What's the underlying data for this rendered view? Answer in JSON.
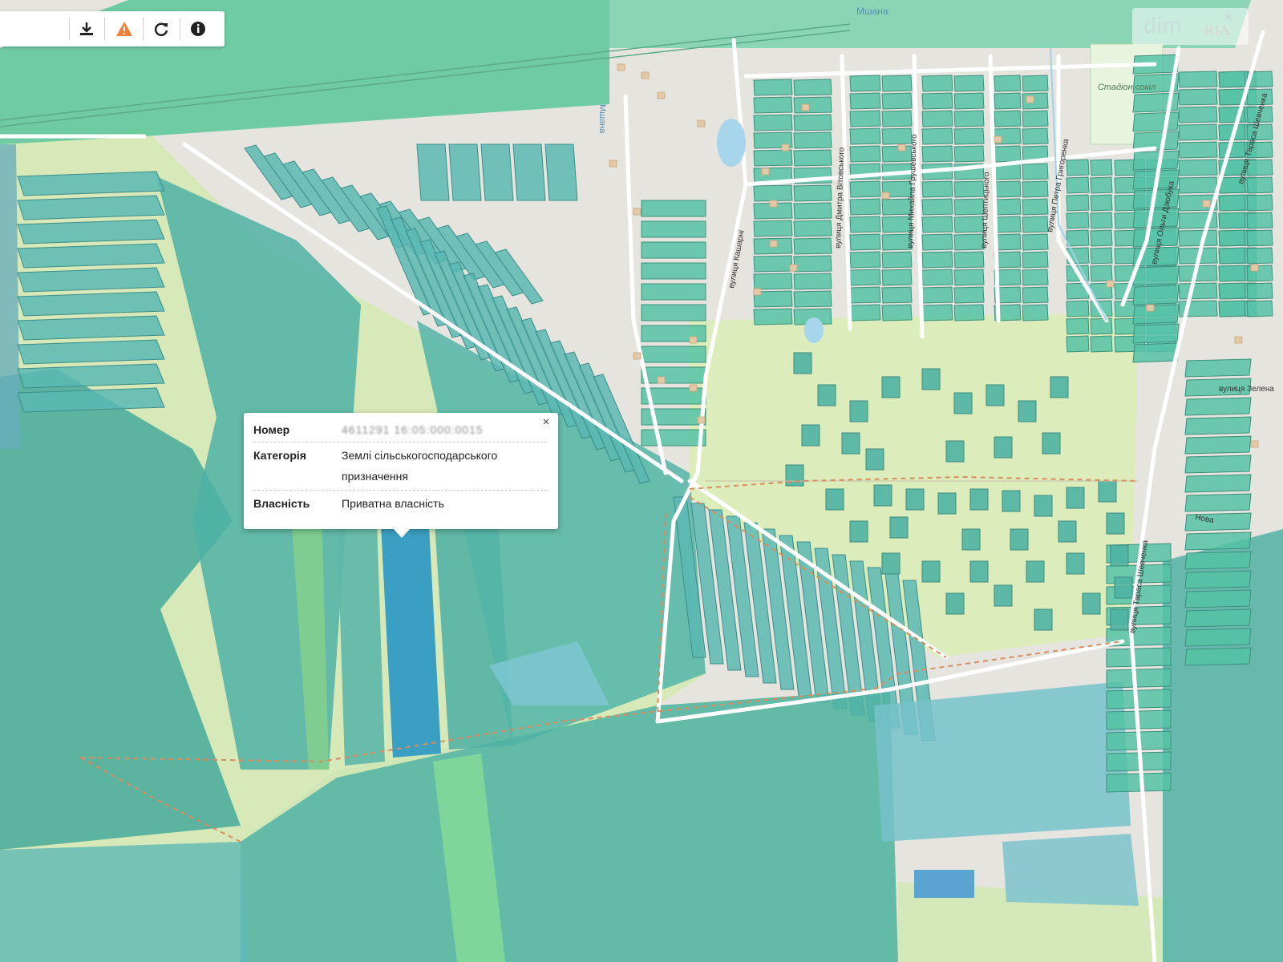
{
  "toolbar": {
    "download_icon": "download-icon",
    "warning_icon": "warning-icon",
    "refresh_icon": "refresh-icon",
    "info_icon": "info-icon",
    "warning_color": "#f0813a"
  },
  "map": {
    "river_label": "Мшана",
    "river_label_2": "Мшана",
    "stadium_label": "Стадіон сокіл",
    "street_1": "вулиця Кашарні",
    "street_2": "вулиця Дмитра Вітовського",
    "street_3": "вулиця Михайла Грушевського",
    "street_4": "вулиця Шептицького",
    "street_5": "вулиця Петра Григоренка",
    "street_6": "вулиця Ольги Дзюбука",
    "street_7": "вулиця Тараса Шевченка",
    "street_8": "вулиця Тараса Шевченка",
    "street_9": "вулиця Зелена",
    "street_10": "Нова"
  },
  "popup": {
    "number_label": "Номер",
    "number_value": "4611291 16:05:000:0015",
    "category_label": "Категорія",
    "category_value": "Землі сільськогосподарського призначення",
    "ownership_label": "Власність",
    "ownership_value": "Приватна власність",
    "close_glyph": "×"
  },
  "watermark": {
    "brand": "dim",
    "sub": "RIA"
  }
}
